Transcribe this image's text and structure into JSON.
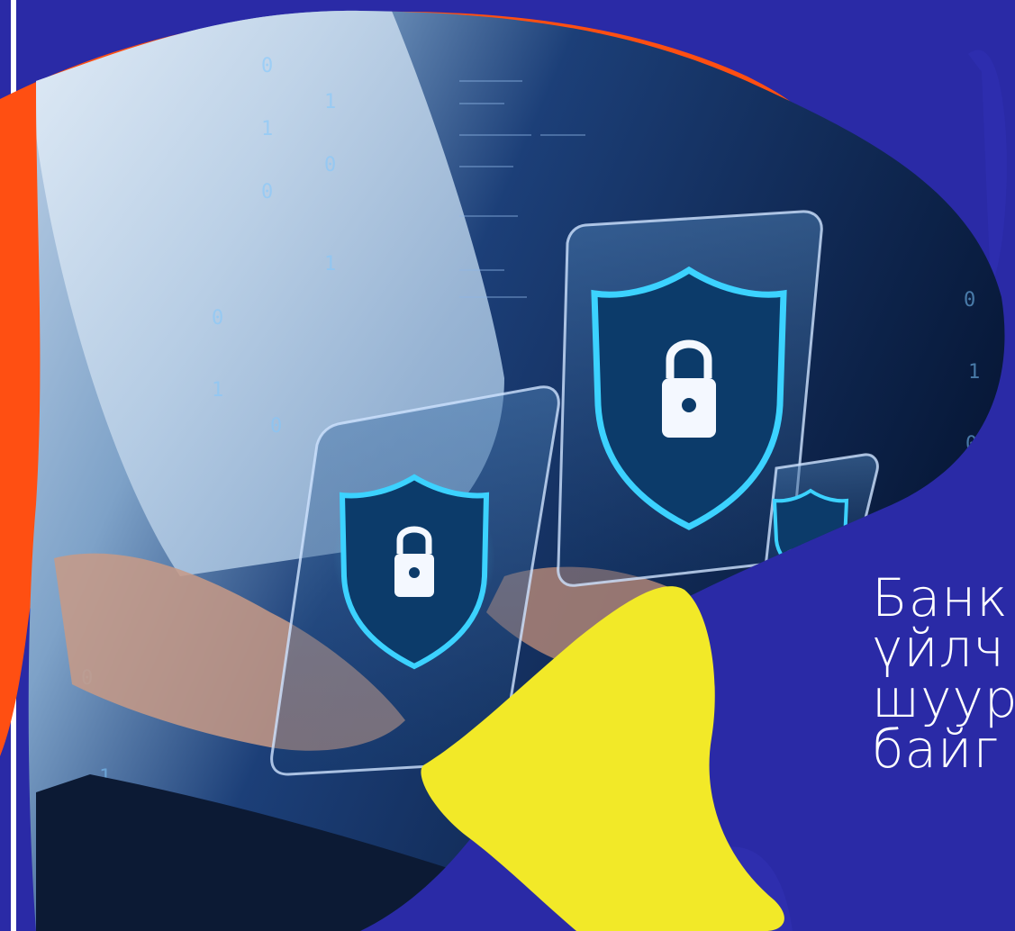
{
  "slide": {
    "headline_lines": [
      "Банк",
      "үйлч",
      "шуур",
      "байг"
    ]
  },
  "colors": {
    "background": "#2a2aa6",
    "orange_blob": "#ff4f12",
    "yellow_blob": "#f2e928",
    "photo_dark": "#0a1f45",
    "shield_glow": "#1fb8e6"
  },
  "image": {
    "subject": "hands-typing-laptop-with-security-shield-lock-icons"
  }
}
